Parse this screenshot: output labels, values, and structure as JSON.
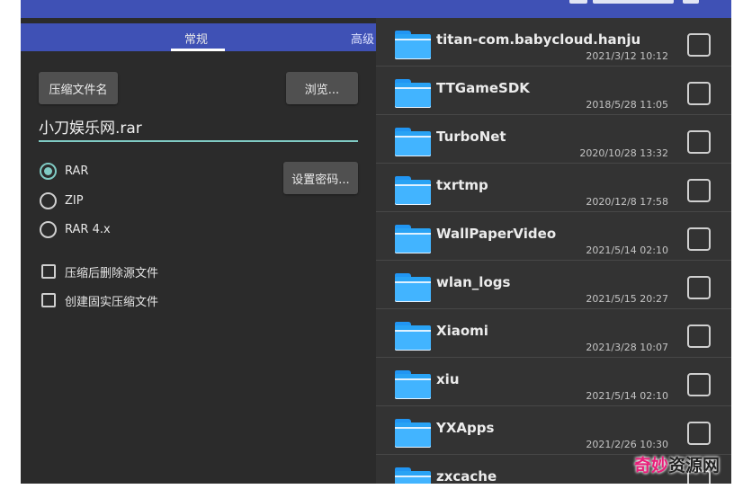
{
  "tabs": {
    "general": "常规",
    "advanced": "高级"
  },
  "buttons": {
    "archive_name": "压缩文件名",
    "browse": "浏览...",
    "set_password": "设置密码..."
  },
  "archive_name_value": "小刀娱乐网.rar",
  "formats": [
    {
      "label": "RAR",
      "selected": true
    },
    {
      "label": "ZIP",
      "selected": false
    },
    {
      "label": "RAR 4.x",
      "selected": false
    }
  ],
  "options": [
    {
      "label": "压缩后删除源文件",
      "checked": false
    },
    {
      "label": "创建固实压缩文件",
      "checked": false
    }
  ],
  "files": [
    {
      "name": "titan-com.babycloud.hanju",
      "date": "2021/3/12 10:12",
      "icon": "folder-icon"
    },
    {
      "name": "TTGameSDK",
      "date": "2018/5/28 11:05",
      "icon": "folder-icon"
    },
    {
      "name": "TurboNet",
      "date": "2020/10/28 13:32",
      "icon": "folder-icon"
    },
    {
      "name": "txrtmp",
      "date": "2020/12/8 17:58",
      "icon": "folder-icon"
    },
    {
      "name": "WallPaperVideo",
      "date": "2021/5/14 02:10",
      "icon": "folder-icon"
    },
    {
      "name": "wlan_logs",
      "date": "2021/5/15 20:27",
      "icon": "folder-icon"
    },
    {
      "name": "Xiaomi",
      "date": "2021/3/28 10:07",
      "icon": "folder-icon"
    },
    {
      "name": "xiu",
      "date": "2021/5/14 02:10",
      "icon": "folder-icon"
    },
    {
      "name": "YXApps",
      "date": "2021/2/26 10:30",
      "icon": "folder-icon"
    },
    {
      "name": "zxcache",
      "date": "",
      "icon": "folder-icon"
    }
  ],
  "watermark": {
    "part1": "奇妙",
    "part2": "资源网"
  },
  "colors": {
    "accent": "#3f51b5",
    "teal": "#80cbc4",
    "folder": "#42b4ff",
    "panel": "#2b2b2b",
    "list": "#333333",
    "watermark": "#e91e7a"
  }
}
